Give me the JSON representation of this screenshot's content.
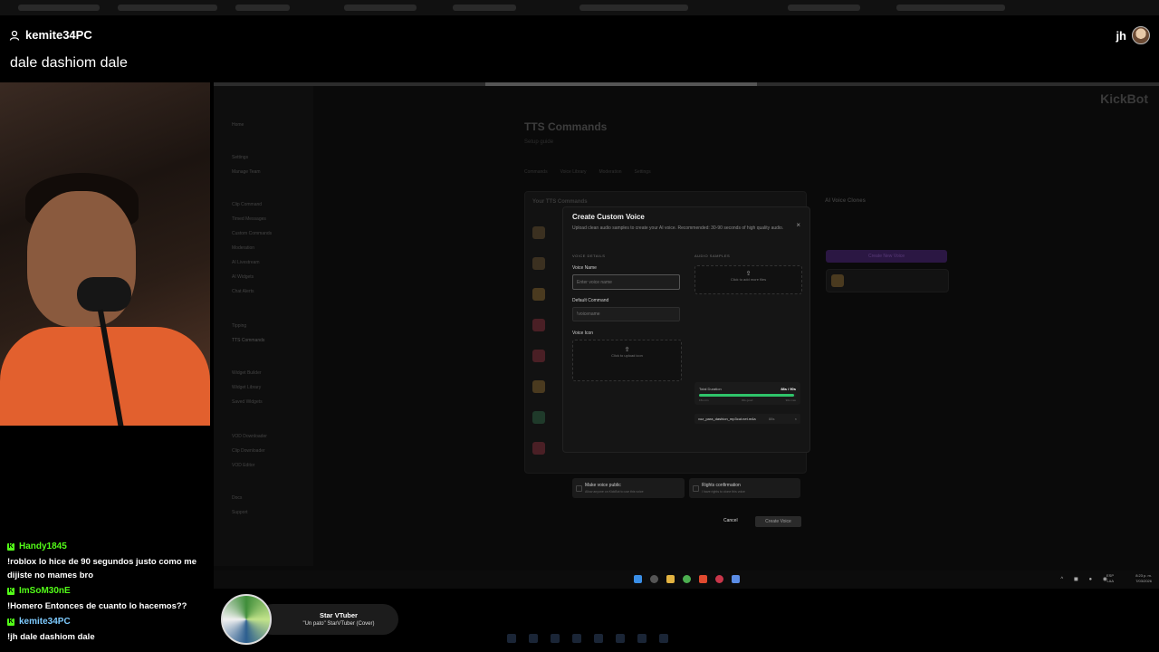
{
  "header": {
    "username": "kemite34PC",
    "message": "dale dashiom dale",
    "right_user": "jh"
  },
  "background_app": {
    "brand": "KickBot",
    "page_title": "TTS Commands",
    "setup_link": "Setup guide",
    "tabs": [
      "Commands",
      "Voice Library",
      "Moderation",
      "Settings"
    ],
    "your_commands_title": "Your TTS Commands",
    "ai_voice_clones_title": "AI Voice Clones",
    "create_new_voice": "Create New Voice",
    "sidebar_items": [
      "Home",
      "Settings",
      "Manage Team",
      "Clip Command",
      "Timed Messages",
      "Custom Commands",
      "Moderation",
      "AI Livestream",
      "AI Widgets",
      "Chat Alerts",
      "Tipping",
      "TTS Commands",
      "Widget Builder",
      "Widget Library",
      "Saved Widgets",
      "VOD Downloader",
      "Clip Downloader",
      "VOD Editor",
      "Docs",
      "Support"
    ]
  },
  "modal": {
    "title": "Create Custom Voice",
    "close_label": "×",
    "description": "Upload clean audio samples to create your AI voice. Recommended: 30-90 seconds of high quality audio.",
    "voice_details_header": "VOICE DETAILS",
    "audio_samples_header": "AUDIO SAMPLES",
    "voice_name_label": "Voice Name",
    "voice_name_placeholder": "Enter voice name",
    "default_command_label": "Default Command",
    "default_command_placeholder": "!voicename",
    "voice_icon_label": "Voice Icon",
    "upload_icon_text": "Click to upload icon",
    "add_more_files_text": "Click to add more files",
    "total_duration_label": "Total Duration",
    "total_duration_value": "88s / 90s",
    "total_duration_fraction": 0.978,
    "duration_ticks": [
      "15s min",
      "30s good",
      "90s max"
    ],
    "file_name": "voz_para_dashion_mp3cut.net.m4a",
    "file_size": "88s",
    "remove_file": "×",
    "make_public_title": "Make voice public",
    "make_public_sub": "Allow anyone on KickBot to use this voice",
    "rights_title": "Rights confirmation",
    "rights_sub": "I have rights to clone this voice",
    "cancel_label": "Cancel",
    "create_label": "Create Voice"
  },
  "taskbar": {
    "lang": "ESP",
    "lang_sub": "LAA",
    "time": "8:23 p. m.",
    "date": "7/03/2026"
  },
  "chat": [
    {
      "user": "Handy1845",
      "message": "!roblox lo hice de 90 segundos justo como me dijiste no mames bro"
    },
    {
      "user": "ImSoM30nE",
      "message": "!Homero Entonces de cuanto lo hacemos??"
    },
    {
      "user": "kemite34PC",
      "message": "!jh dale dashiom dale"
    }
  ],
  "now_playing": {
    "title": "Star VTuber",
    "subtitle": "\"Un pato\" StarVTuber (Cover)"
  },
  "colors": {
    "kick_green": "#53fc18",
    "duration_green": "#2fc46a"
  }
}
